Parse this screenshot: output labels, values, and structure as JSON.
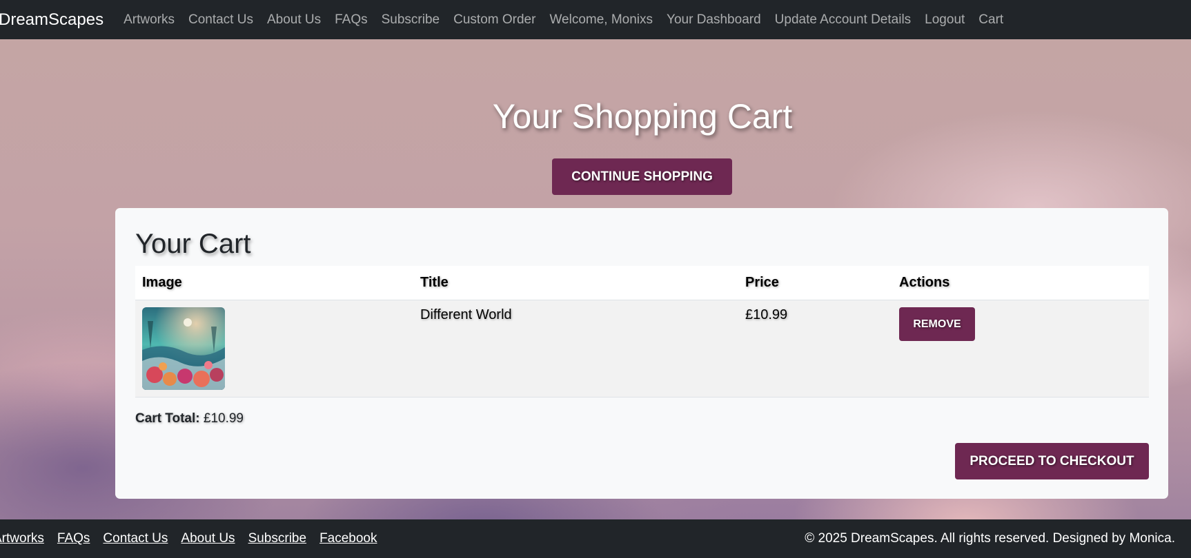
{
  "navbar": {
    "brand": "DreamScapes",
    "links": [
      "Artworks",
      "Contact Us",
      "About Us",
      "FAQs",
      "Subscribe",
      "Custom Order",
      "Welcome, Monixs",
      "Your Dashboard",
      "Update Account Details",
      "Logout",
      "Cart"
    ]
  },
  "hero": {
    "title": "Your Shopping Cart",
    "continue_label": "CONTINUE SHOPPING"
  },
  "cart": {
    "heading": "Your Cart",
    "columns": [
      "Image",
      "Title",
      "Price",
      "Actions"
    ],
    "items": [
      {
        "image_alt": "Underwater coral reef artwork",
        "title": "Different World",
        "price": "£10.99",
        "action_label": "REMOVE"
      }
    ],
    "total_label": "Cart Total:",
    "total_value": " £10.99",
    "checkout_label": "PROCEED TO CHECKOUT"
  },
  "footer": {
    "links": [
      "Artworks",
      "FAQs",
      "Contact Us",
      "About Us",
      "Subscribe",
      "Facebook"
    ],
    "copyright": "© 2025 DreamScapes. All rights reserved. Designed by Monica."
  },
  "colors": {
    "accent": "#6e2852",
    "navbar_bg": "#212529"
  }
}
